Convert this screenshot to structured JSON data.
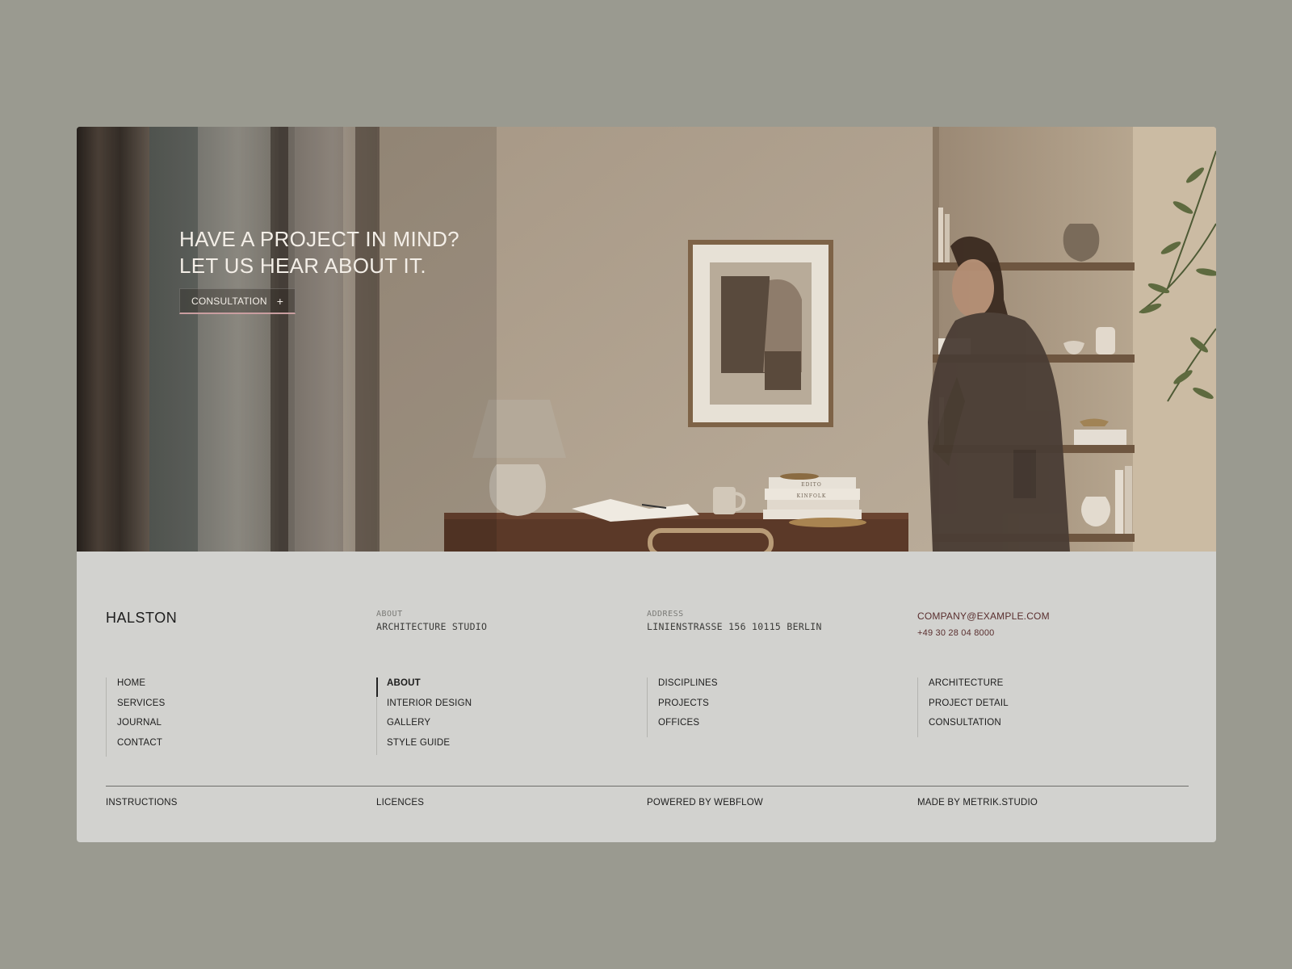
{
  "hero": {
    "headline_line1": "HAVE A PROJECT IN MIND?",
    "headline_line2": "LET US HEAR ABOUT IT.",
    "cta_label": "CONSULTATION",
    "cta_icon": "+",
    "book_spines": [
      "EDITO",
      "KINFOLK"
    ]
  },
  "footer": {
    "brand": "HALSTON",
    "about": {
      "label": "ABOUT",
      "value": "ARCHITECTURE STUDIO"
    },
    "address": {
      "label": "ADDRESS",
      "value": "LINIENSTRASSE 156 10115 BERLIN"
    },
    "contact": {
      "email": "COMPANY@EXAMPLE.COM",
      "phone": "+49 30 28 04 8000"
    },
    "nav_columns": [
      {
        "items": [
          "HOME",
          "SERVICES",
          "JOURNAL",
          "CONTACT"
        ]
      },
      {
        "items": [
          "ABOUT",
          "INTERIOR DESIGN",
          "GALLERY",
          "STYLE GUIDE"
        ],
        "active": "ABOUT"
      },
      {
        "items": [
          "DISCIPLINES",
          "PROJECTS",
          "OFFICES"
        ]
      },
      {
        "items": [
          "ARCHITECTURE",
          "PROJECT DETAIL",
          "CONSULTATION"
        ]
      }
    ],
    "bottom_links": [
      "INSTRUCTIONS",
      "LICENCES",
      "POWERED BY WEBFLOW",
      "MADE BY METRIK.STUDIO"
    ]
  },
  "colors": {
    "page_bg": "#9a9a90",
    "footer_bg": "#d2d2cf",
    "cta_underline": "#c99ea0",
    "contact_text": "#5a2f2f"
  }
}
